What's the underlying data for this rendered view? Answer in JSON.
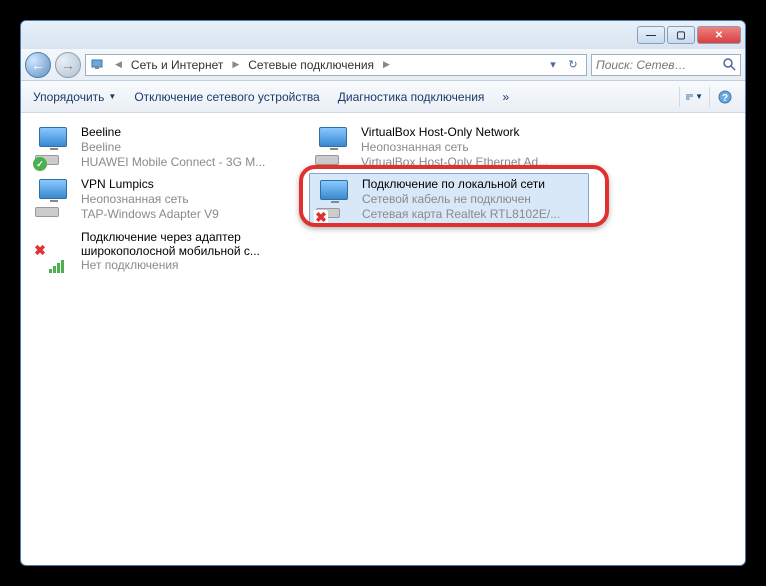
{
  "nav": {
    "crumb1": "Сеть и Интернет",
    "crumb2": "Сетевые подключения"
  },
  "search": {
    "placeholder": "Поиск: Сетев…"
  },
  "toolbar": {
    "organize": "Упорядочить",
    "disable": "Отключение сетевого устройства",
    "diagnose": "Диагностика подключения",
    "more": "»"
  },
  "items": [
    {
      "name": "Beeline",
      "status": "Beeline",
      "device": "HUAWEI Mobile Connect - 3G M...",
      "overlay": "check"
    },
    {
      "name": "VirtualBox Host-Only Network",
      "status": "Неопознанная сеть",
      "device": "VirtualBox Host-Only Ethernet Ad...",
      "overlay": "none"
    },
    {
      "name": "VPN Lumpics",
      "status": "Неопознанная сеть",
      "device": "TAP-Windows Adapter V9",
      "overlay": "none"
    },
    {
      "name": "Подключение по локальной сети",
      "status": "Сетевой кабель не подключен",
      "device": "Сетевая карта Realtek RTL8102E/...",
      "overlay": "x",
      "selected": true
    },
    {
      "name": "Подключение через адаптер широкополосной мобильной с...",
      "status": "Нет подключения",
      "device": "",
      "overlay": "signal-x"
    }
  ]
}
